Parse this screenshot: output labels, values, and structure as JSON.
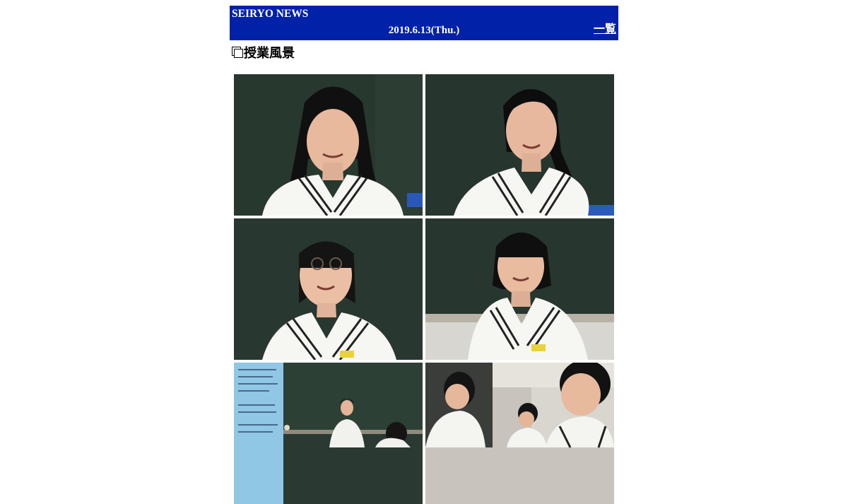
{
  "header": {
    "site_title": "SEIRYO NEWS",
    "date": "2019.6.13(Thu.)",
    "list_link": "一覧",
    "background_color": "#0021a8"
  },
  "article": {
    "title": "授業風景",
    "title_icon": "window-icon"
  },
  "photos": [
    {
      "description": "student-long-hair-smiling"
    },
    {
      "description": "student-ponytail-looking-up"
    },
    {
      "description": "student-glasses-smiling"
    },
    {
      "description": "student-bob-hair-smiling"
    },
    {
      "description": "student-presenting-at-blackboard"
    },
    {
      "description": "students-watching-class"
    }
  ]
}
